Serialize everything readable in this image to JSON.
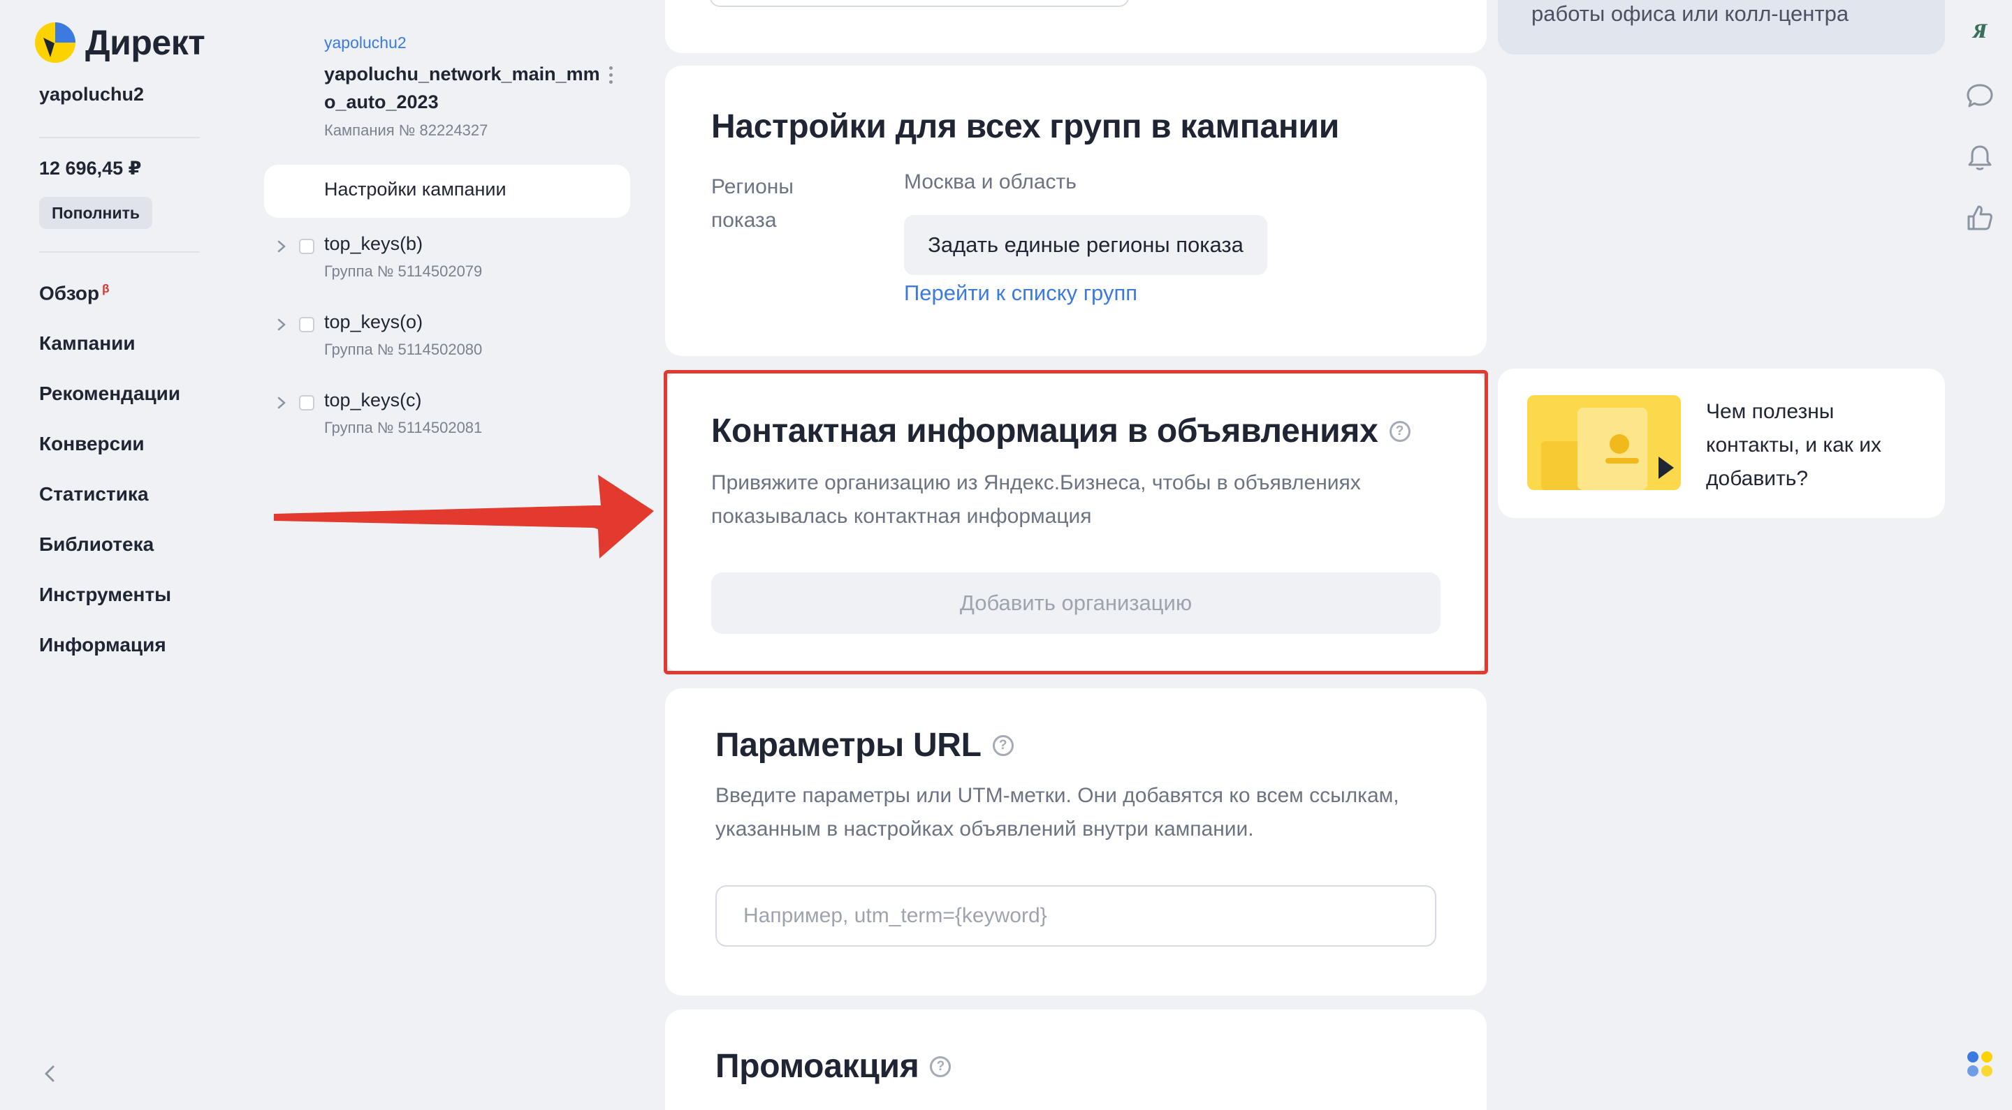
{
  "app": {
    "logo_text": "Директ",
    "username": "yapoluchu2",
    "balance": "12 696,45 ₽",
    "topup_label": "Пополнить"
  },
  "nav": {
    "items": [
      {
        "label": "Обзор",
        "badge": "β"
      },
      {
        "label": "Кампании"
      },
      {
        "label": "Рекомендации"
      },
      {
        "label": "Конверсии"
      },
      {
        "label": "Статистика"
      },
      {
        "label": "Библиотека"
      },
      {
        "label": "Инструменты"
      },
      {
        "label": "Информация"
      }
    ]
  },
  "tree": {
    "login": "yapoluchu2",
    "campaign_name": "yapoluchu_network_main_mmo_auto_2023",
    "campaign_number": "Кампания № 82224327",
    "settings_label": "Настройки кампании",
    "groups": [
      {
        "name": "top_keys(b)",
        "number": "Группа № 5114502079"
      },
      {
        "name": "top_keys(o)",
        "number": "Группа № 5114502080"
      },
      {
        "name": "top_keys(c)",
        "number": "Группа № 5114502081"
      }
    ]
  },
  "regions": {
    "title": "Настройки для всех групп в кампании",
    "label": "Регионы показа",
    "value": "Москва и область",
    "set_button": "Задать единые регионы показа",
    "link": "Перейти к списку групп"
  },
  "contact": {
    "title": "Контактная информация в объявлениях",
    "description": "Привяжите организацию из Яндекс.Бизнеса, чтобы в объявлениях показывалась контактная информация",
    "add_button": "Добавить организацию"
  },
  "url_params": {
    "title": "Параметры URL",
    "description": "Введите параметры или UTM-метки. Они добавятся ко всем ссылкам, указанным в настройках объявлений внутри кампании.",
    "placeholder": "Например, utm_term={keyword}",
    "value": ""
  },
  "promo": {
    "title": "Промоакция"
  },
  "right": {
    "top_tip_text": "работы офиса или колл-центра",
    "tip_card_text": "Чем полезны контакты, и как их добавить?"
  },
  "toolbar": {
    "icons": [
      "ya-icon",
      "chat-icon",
      "bell-icon",
      "thumbs-up-icon",
      "apps-icon"
    ],
    "ya_label": "Я"
  },
  "colors": {
    "accent_link": "#3b7be0",
    "highlight": "#e23a2e",
    "background": "#eff1f5",
    "logo_yellow": "#fcd200",
    "logo_blue": "#3b7be0"
  }
}
